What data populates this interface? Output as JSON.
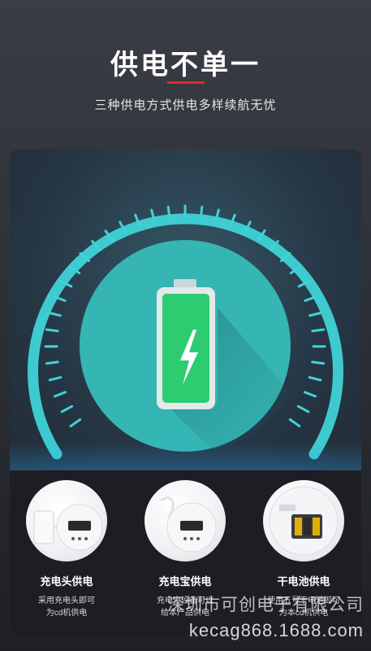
{
  "header": {
    "title": "供电不单一",
    "subtitle": "三种供电方式供电多样续航无忧"
  },
  "colors": {
    "accent_red": "#e02a2a",
    "gauge_teal": "#3fd3d7",
    "battery_green": "#2ecc71"
  },
  "features": [
    {
      "title": "充电头供电",
      "desc_line1": "采用充电头即可",
      "desc_line2": "为cd机供电",
      "icon": "charger-photo"
    },
    {
      "title": "充电宝供电",
      "desc_line1": "充电宝设备可以",
      "desc_line2": "给本产品供电",
      "icon": "powerbank-photo"
    },
    {
      "title": "干电池供电",
      "desc_line1": "使用五号干电池即可",
      "desc_line2": "为本cd机供电",
      "icon": "battery-photo"
    }
  ],
  "watermark": {
    "company": "深圳市可创电子有限公司",
    "shop": "kecag868.1688.com"
  }
}
